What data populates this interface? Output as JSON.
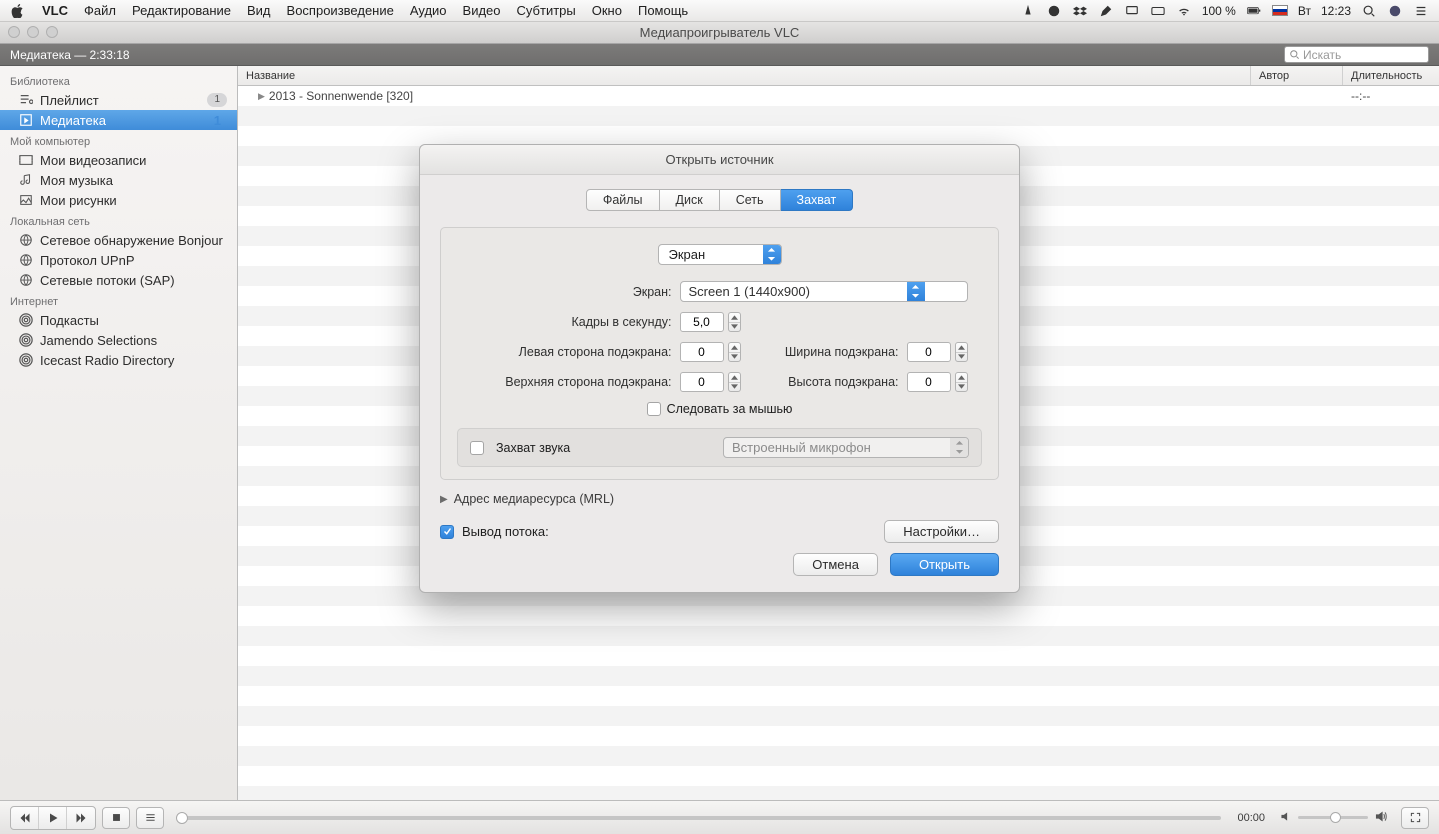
{
  "menubar": {
    "app": "VLC",
    "items": [
      "Файл",
      "Редактирование",
      "Вид",
      "Воспроизведение",
      "Аудио",
      "Видео",
      "Субтитры",
      "Окно",
      "Помощь"
    ],
    "battery": "100 %",
    "day": "Вт",
    "time": "12:23"
  },
  "window": {
    "title": "Медиапроигрыватель VLC",
    "toolbar_label": "Медиатека — 2:33:18",
    "search_placeholder": "Искать"
  },
  "sidebar": {
    "sections": {
      "library": "Библиотека",
      "my_computer": "Мой компьютер",
      "lan": "Локальная сеть",
      "internet": "Интернет"
    },
    "library_items": [
      {
        "label": "Плейлист",
        "badge": "1"
      },
      {
        "label": "Медиатека",
        "count": "1",
        "selected": true
      }
    ],
    "my_computer_items": [
      {
        "label": "Мои видеозаписи"
      },
      {
        "label": "Моя музыка"
      },
      {
        "label": "Мои рисунки"
      }
    ],
    "lan_items": [
      {
        "label": "Сетевое обнаружение Bonjour"
      },
      {
        "label": "Протокол UPnP"
      },
      {
        "label": "Сетевые потоки (SAP)"
      }
    ],
    "internet_items": [
      {
        "label": "Подкасты"
      },
      {
        "label": "Jamendo Selections"
      },
      {
        "label": "Icecast Radio Directory"
      }
    ]
  },
  "columns": {
    "title": "Название",
    "author": "Автор",
    "duration": "Длительность"
  },
  "rows": [
    {
      "title": "2013 - Sonnenwende [320]",
      "author": "",
      "duration": "--:--"
    }
  ],
  "player": {
    "time": "00:00"
  },
  "dialog": {
    "title": "Открыть источник",
    "tabs": [
      "Файлы",
      "Диск",
      "Сеть",
      "Захват"
    ],
    "active_tab": 3,
    "capture_source": "Экран",
    "screen_label": "Экран:",
    "screen_value": "Screen 1 (1440x900)",
    "fps_label": "Кадры в секунду:",
    "fps_value": "5,0",
    "left_label": "Левая сторона подэкрана:",
    "left_value": "0",
    "width_label": "Ширина подэкрана:",
    "width_value": "0",
    "top_label": "Верхняя сторона подэкрана:",
    "top_value": "0",
    "height_label": "Высота подэкрана:",
    "height_value": "0",
    "follow_mouse": "Следовать за мышью",
    "capture_audio": "Захват звука",
    "audio_device": "Встроенный микрофон",
    "mrl": "Адрес медиаресурса (MRL)",
    "stream_output": "Вывод потока:",
    "settings_btn": "Настройки…",
    "cancel": "Отмена",
    "open": "Открыть"
  }
}
